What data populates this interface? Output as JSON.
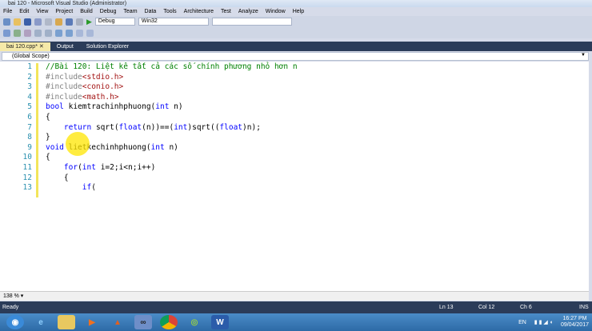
{
  "window": {
    "title": "bai 120 - Microsoft Visual Studio (Administrator)"
  },
  "menu": [
    "File",
    "Edit",
    "View",
    "Project",
    "Build",
    "Debug",
    "Team",
    "Data",
    "Tools",
    "Architecture",
    "Test",
    "Analyze",
    "Window",
    "Help"
  ],
  "toolbar": {
    "config": "Debug",
    "platform": "Win32"
  },
  "tabs": [
    {
      "label": "bai 120.cpp*",
      "active": true
    },
    {
      "label": "Output"
    },
    {
      "label": "Solution Explorer"
    }
  ],
  "scope": "(Global Scope)",
  "code_lines": [
    "//Bài 120: Liệt kê tất cả các số chính phương nhỏ hơn n",
    "#include<stdio.h>",
    "#include<conio.h>",
    "#include<math.h>",
    "bool kiemtrachinhphuong(int n)",
    "{",
    "    return sqrt(float(n))==(int)sqrt((float)n);",
    "}",
    "void lietkechinhphuong(int n)",
    "{",
    "    for(int i=2;i<n;i++)",
    "    {",
    "        if(",
    ""
  ],
  "zoom": "138 %",
  "status": {
    "text": "Ready",
    "ln": "Ln 13",
    "col": "Col 12",
    "ch": "Ch 6",
    "mode": "INS"
  },
  "tray": {
    "lang": "EN",
    "time": "16:27 PM",
    "date": "09/04/2017"
  }
}
